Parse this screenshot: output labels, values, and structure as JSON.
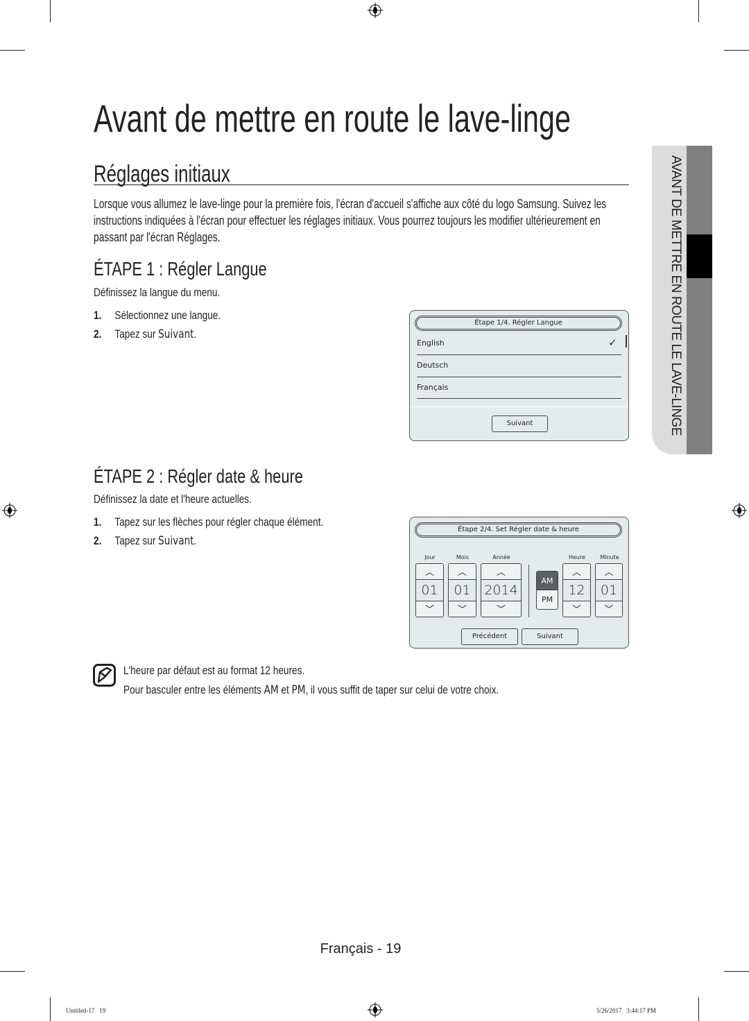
{
  "page": {
    "title": "Avant de mettre en route le lave-linge",
    "section_title": "Réglages initiaux",
    "intro": "Lorsque vous allumez le lave-linge pour la première fois, l'écran d'accueil s'affiche aux côté du logo Samsung. Suivez les instructions indiquées à l'écran pour effectuer les réglages initiaux. Vous pourrez toujours les modifier ultérieurement en passant par l'écran Réglages."
  },
  "step1": {
    "heading": "ÉTAPE 1 : Régler Langue",
    "desc": "Définissez la langue du menu.",
    "items": [
      {
        "n": "1.",
        "text": "Sélectionnez une langue.",
        "bold": ""
      },
      {
        "n": "2.",
        "text": "Tapez sur ",
        "bold": "Suivant",
        "end": "."
      }
    ],
    "screen": {
      "title": "Étape 1/4. Régler Langue",
      "languages": [
        "English",
        "Deutsch",
        "Français"
      ],
      "selected": "English",
      "next": "Suivant"
    }
  },
  "step2": {
    "heading": "ÉTAPE 2 : Régler date & heure",
    "desc": "Définissez la date et l'heure actuelles.",
    "items": [
      {
        "n": "1.",
        "text": "Tapez sur les flèches pour régler chaque élément.",
        "bold": ""
      },
      {
        "n": "2.",
        "text": "Tapez sur ",
        "bold": "Suivant",
        "end": "."
      }
    ],
    "screen": {
      "title": "Étape 2/4. Set Régler date & heure",
      "labels": {
        "day": "Jour",
        "month": "Mois",
        "year": "Année",
        "hour": "Heure",
        "minute": "Minute"
      },
      "values": {
        "day": "01",
        "month": "01",
        "year": "2014",
        "hour": "12",
        "minute": "01"
      },
      "am": "AM",
      "pm": "PM",
      "selected_period": "AM",
      "prev": "Précédent",
      "next": "Suivant"
    }
  },
  "note": {
    "line1": "L'heure par défaut est au format 12 heures.",
    "line2_a": "Pour basculer entre les éléments ",
    "am": "AM",
    "et": " et ",
    "pm": "PM",
    "line2_b": ", il vous suffit de taper sur celui de votre choix."
  },
  "side_tab": "AVANT DE METTRE EN ROUTE LE LAVE-LINGE",
  "footer": {
    "page": "Français - 19",
    "file": "Untitled-17   19",
    "date": "5/26/2017   3:44:17 PM"
  },
  "colors": {
    "screen_bg": "#e4ebea",
    "am_selected": "#5a5f60",
    "tab_light": "#dcdcdc",
    "tab_dark": "#808080"
  }
}
